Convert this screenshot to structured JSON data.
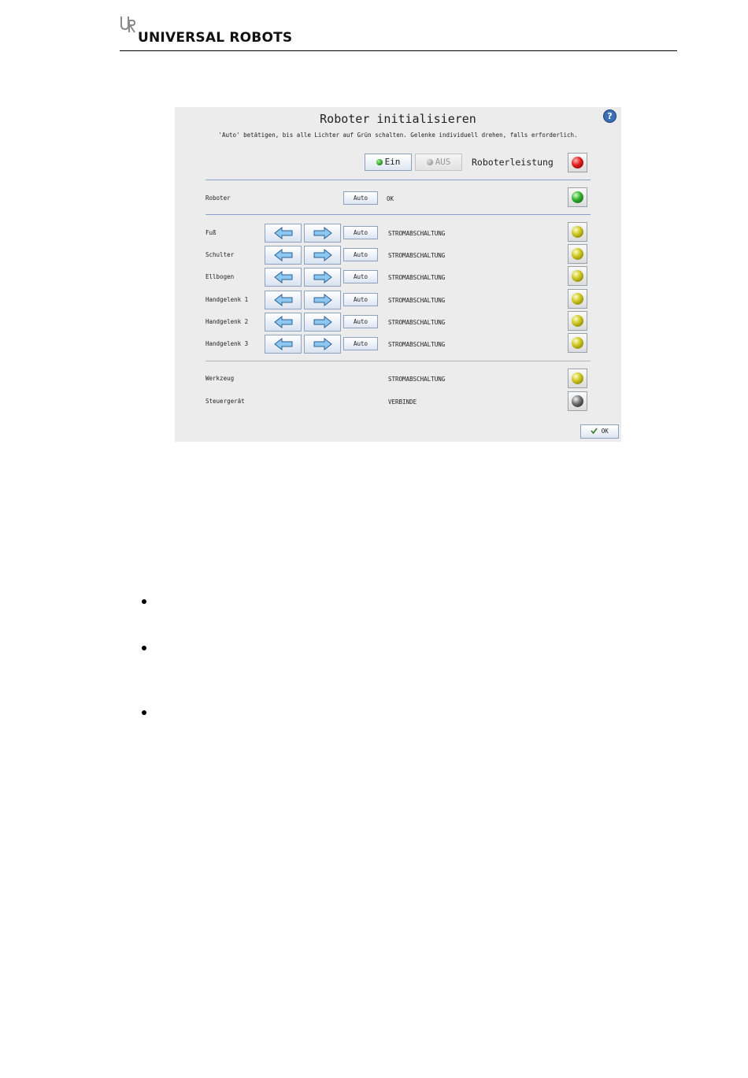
{
  "header": {
    "brand": "UNIVERSAL ROBOTS",
    "logo": "ur-logo"
  },
  "dialog": {
    "title": "Roboter initialisieren",
    "instruction": "'Auto' betätigen, bis alle Lichter auf Grün schalten. Gelenke individuell drehen, falls erforderlich.",
    "help_icon": "question-mark-icon",
    "power": {
      "on_label": "Ein",
      "off_label": "AUS",
      "label": "Roboterleistung",
      "lamp_color": "#e01a1a"
    },
    "robot": {
      "label": "Roboter",
      "auto_label": "Auto",
      "status": "OK",
      "lamp_color": "#2fae2a"
    },
    "joints": [
      {
        "label": "Fuß",
        "auto_label": "Auto",
        "status": "STROMABSCHALTUNG"
      },
      {
        "label": "Schulter",
        "auto_label": "Auto",
        "status": "STROMABSCHALTUNG"
      },
      {
        "label": "Ellbogen",
        "auto_label": "Auto",
        "status": "STROMABSCHALTUNG"
      },
      {
        "label": "Handgelenk 1",
        "auto_label": "Auto",
        "status": "STROMABSCHALTUNG"
      },
      {
        "label": "Handgelenk 2",
        "auto_label": "Auto",
        "status": "STROMABSCHALTUNG"
      },
      {
        "label": "Handgelenk 3",
        "auto_label": "Auto",
        "status": "STROMABSCHALTUNG"
      }
    ],
    "joint_lamp_color": "#c9c21a",
    "tool": {
      "label": "Werkzeug",
      "status": "STROMABSCHALTUNG",
      "lamp_color": "#c9c21a"
    },
    "controller": {
      "label": "Steuergerät",
      "status": "VERBINDE",
      "lamp_color": "#6b6b6b"
    },
    "ok_label": "OK"
  },
  "colors": {
    "dialog_bg": "#ececec",
    "separator_blue": "#8aa0c8",
    "arrow_fill": "#8cc8f2"
  }
}
